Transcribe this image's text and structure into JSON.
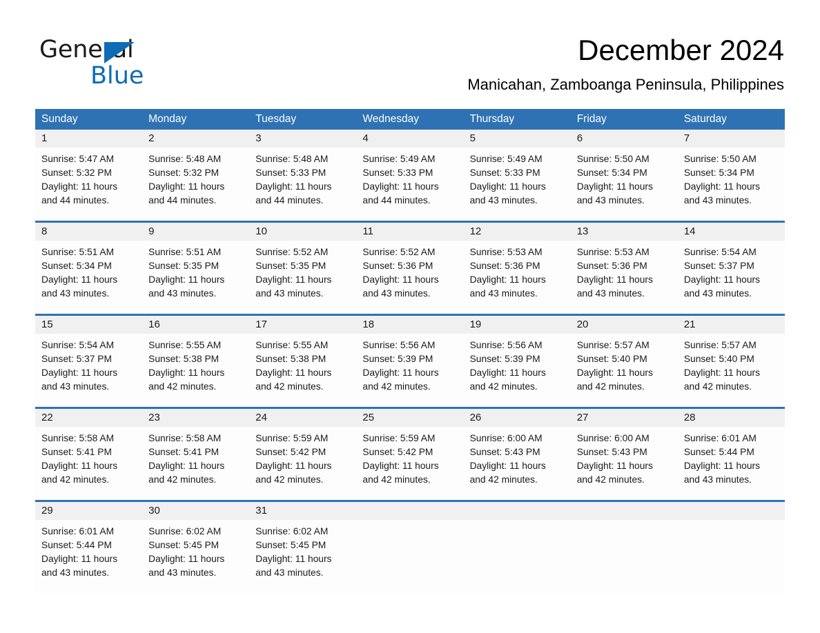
{
  "logo": {
    "text_dark": "General",
    "text_blue": "Blue",
    "triangle_color": "#0d6cb5"
  },
  "header": {
    "title": "December 2024",
    "subtitle": "Manicahan, Zamboanga Peninsula, Philippines"
  },
  "colors": {
    "header_blue": "#2e72b3",
    "separator_blue": "#2e72b3",
    "daynum_band": "#f0f0f0",
    "cell_background": "#fdfdfd",
    "text": "#1a1a1a",
    "logo_blue": "#0d6cb5"
  },
  "weekdays": [
    "Sunday",
    "Monday",
    "Tuesday",
    "Wednesday",
    "Thursday",
    "Friday",
    "Saturday"
  ],
  "weeks": [
    [
      {
        "day": "1",
        "sunrise": "Sunrise: 5:47 AM",
        "sunset": "Sunset: 5:32 PM",
        "daylight1": "Daylight: 11 hours",
        "daylight2": "and 44 minutes."
      },
      {
        "day": "2",
        "sunrise": "Sunrise: 5:48 AM",
        "sunset": "Sunset: 5:32 PM",
        "daylight1": "Daylight: 11 hours",
        "daylight2": "and 44 minutes."
      },
      {
        "day": "3",
        "sunrise": "Sunrise: 5:48 AM",
        "sunset": "Sunset: 5:33 PM",
        "daylight1": "Daylight: 11 hours",
        "daylight2": "and 44 minutes."
      },
      {
        "day": "4",
        "sunrise": "Sunrise: 5:49 AM",
        "sunset": "Sunset: 5:33 PM",
        "daylight1": "Daylight: 11 hours",
        "daylight2": "and 44 minutes."
      },
      {
        "day": "5",
        "sunrise": "Sunrise: 5:49 AM",
        "sunset": "Sunset: 5:33 PM",
        "daylight1": "Daylight: 11 hours",
        "daylight2": "and 43 minutes."
      },
      {
        "day": "6",
        "sunrise": "Sunrise: 5:50 AM",
        "sunset": "Sunset: 5:34 PM",
        "daylight1": "Daylight: 11 hours",
        "daylight2": "and 43 minutes."
      },
      {
        "day": "7",
        "sunrise": "Sunrise: 5:50 AM",
        "sunset": "Sunset: 5:34 PM",
        "daylight1": "Daylight: 11 hours",
        "daylight2": "and 43 minutes."
      }
    ],
    [
      {
        "day": "8",
        "sunrise": "Sunrise: 5:51 AM",
        "sunset": "Sunset: 5:34 PM",
        "daylight1": "Daylight: 11 hours",
        "daylight2": "and 43 minutes."
      },
      {
        "day": "9",
        "sunrise": "Sunrise: 5:51 AM",
        "sunset": "Sunset: 5:35 PM",
        "daylight1": "Daylight: 11 hours",
        "daylight2": "and 43 minutes."
      },
      {
        "day": "10",
        "sunrise": "Sunrise: 5:52 AM",
        "sunset": "Sunset: 5:35 PM",
        "daylight1": "Daylight: 11 hours",
        "daylight2": "and 43 minutes."
      },
      {
        "day": "11",
        "sunrise": "Sunrise: 5:52 AM",
        "sunset": "Sunset: 5:36 PM",
        "daylight1": "Daylight: 11 hours",
        "daylight2": "and 43 minutes."
      },
      {
        "day": "12",
        "sunrise": "Sunrise: 5:53 AM",
        "sunset": "Sunset: 5:36 PM",
        "daylight1": "Daylight: 11 hours",
        "daylight2": "and 43 minutes."
      },
      {
        "day": "13",
        "sunrise": "Sunrise: 5:53 AM",
        "sunset": "Sunset: 5:36 PM",
        "daylight1": "Daylight: 11 hours",
        "daylight2": "and 43 minutes."
      },
      {
        "day": "14",
        "sunrise": "Sunrise: 5:54 AM",
        "sunset": "Sunset: 5:37 PM",
        "daylight1": "Daylight: 11 hours",
        "daylight2": "and 43 minutes."
      }
    ],
    [
      {
        "day": "15",
        "sunrise": "Sunrise: 5:54 AM",
        "sunset": "Sunset: 5:37 PM",
        "daylight1": "Daylight: 11 hours",
        "daylight2": "and 43 minutes."
      },
      {
        "day": "16",
        "sunrise": "Sunrise: 5:55 AM",
        "sunset": "Sunset: 5:38 PM",
        "daylight1": "Daylight: 11 hours",
        "daylight2": "and 42 minutes."
      },
      {
        "day": "17",
        "sunrise": "Sunrise: 5:55 AM",
        "sunset": "Sunset: 5:38 PM",
        "daylight1": "Daylight: 11 hours",
        "daylight2": "and 42 minutes."
      },
      {
        "day": "18",
        "sunrise": "Sunrise: 5:56 AM",
        "sunset": "Sunset: 5:39 PM",
        "daylight1": "Daylight: 11 hours",
        "daylight2": "and 42 minutes."
      },
      {
        "day": "19",
        "sunrise": "Sunrise: 5:56 AM",
        "sunset": "Sunset: 5:39 PM",
        "daylight1": "Daylight: 11 hours",
        "daylight2": "and 42 minutes."
      },
      {
        "day": "20",
        "sunrise": "Sunrise: 5:57 AM",
        "sunset": "Sunset: 5:40 PM",
        "daylight1": "Daylight: 11 hours",
        "daylight2": "and 42 minutes."
      },
      {
        "day": "21",
        "sunrise": "Sunrise: 5:57 AM",
        "sunset": "Sunset: 5:40 PM",
        "daylight1": "Daylight: 11 hours",
        "daylight2": "and 42 minutes."
      }
    ],
    [
      {
        "day": "22",
        "sunrise": "Sunrise: 5:58 AM",
        "sunset": "Sunset: 5:41 PM",
        "daylight1": "Daylight: 11 hours",
        "daylight2": "and 42 minutes."
      },
      {
        "day": "23",
        "sunrise": "Sunrise: 5:58 AM",
        "sunset": "Sunset: 5:41 PM",
        "daylight1": "Daylight: 11 hours",
        "daylight2": "and 42 minutes."
      },
      {
        "day": "24",
        "sunrise": "Sunrise: 5:59 AM",
        "sunset": "Sunset: 5:42 PM",
        "daylight1": "Daylight: 11 hours",
        "daylight2": "and 42 minutes."
      },
      {
        "day": "25",
        "sunrise": "Sunrise: 5:59 AM",
        "sunset": "Sunset: 5:42 PM",
        "daylight1": "Daylight: 11 hours",
        "daylight2": "and 42 minutes."
      },
      {
        "day": "26",
        "sunrise": "Sunrise: 6:00 AM",
        "sunset": "Sunset: 5:43 PM",
        "daylight1": "Daylight: 11 hours",
        "daylight2": "and 42 minutes."
      },
      {
        "day": "27",
        "sunrise": "Sunrise: 6:00 AM",
        "sunset": "Sunset: 5:43 PM",
        "daylight1": "Daylight: 11 hours",
        "daylight2": "and 42 minutes."
      },
      {
        "day": "28",
        "sunrise": "Sunrise: 6:01 AM",
        "sunset": "Sunset: 5:44 PM",
        "daylight1": "Daylight: 11 hours",
        "daylight2": "and 43 minutes."
      }
    ],
    [
      {
        "day": "29",
        "sunrise": "Sunrise: 6:01 AM",
        "sunset": "Sunset: 5:44 PM",
        "daylight1": "Daylight: 11 hours",
        "daylight2": "and 43 minutes."
      },
      {
        "day": "30",
        "sunrise": "Sunrise: 6:02 AM",
        "sunset": "Sunset: 5:45 PM",
        "daylight1": "Daylight: 11 hours",
        "daylight2": "and 43 minutes."
      },
      {
        "day": "31",
        "sunrise": "Sunrise: 6:02 AM",
        "sunset": "Sunset: 5:45 PM",
        "daylight1": "Daylight: 11 hours",
        "daylight2": "and 43 minutes."
      },
      {
        "day": "",
        "sunrise": "",
        "sunset": "",
        "daylight1": "",
        "daylight2": ""
      },
      {
        "day": "",
        "sunrise": "",
        "sunset": "",
        "daylight1": "",
        "daylight2": ""
      },
      {
        "day": "",
        "sunrise": "",
        "sunset": "",
        "daylight1": "",
        "daylight2": ""
      },
      {
        "day": "",
        "sunrise": "",
        "sunset": "",
        "daylight1": "",
        "daylight2": ""
      }
    ]
  ]
}
